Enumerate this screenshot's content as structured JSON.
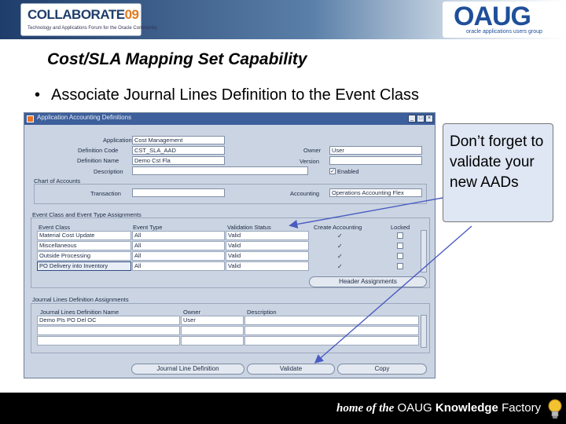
{
  "header": {
    "collaborate_logo": "COLLABORATE",
    "collaborate_year": "09",
    "collaborate_tagline": "Technology and Applications Forum for the Oracle Community",
    "oaug_logo": "OAUG",
    "oaug_tagline": "oracle applications users group"
  },
  "slide": {
    "title": "Cost/SLA Mapping Set Capability",
    "bullet": "Associate Journal Lines Definition to the Event Class"
  },
  "window": {
    "title": "Application Accounting Definitions",
    "fields": {
      "application_label": "Application",
      "application_value": "Cost Management",
      "definition_code_label": "Definition Code",
      "definition_code_value": "CST_SLA_AAD",
      "definition_name_label": "Definition Name",
      "definition_name_value": "Demo Cst Fla",
      "description_label": "Description",
      "description_value": "",
      "owner_label": "Owner",
      "owner_value": "User",
      "version_label": "Version",
      "version_value": "",
      "enabled_label": "Enabled",
      "chart_of_accounts_label": "Chart of Accounts",
      "transaction_label": "Transaction",
      "transaction_value": "",
      "accounting_label": "Accounting",
      "accounting_value": "Operations Accounting Flex"
    },
    "event_section_title": "Event Class and Event Type Assignments",
    "event_table": {
      "headers": [
        "Event Class",
        "Event Type",
        "Validation Status",
        "Create Accounting",
        "Locked"
      ],
      "rows": [
        {
          "event_class": "Material Cost Update",
          "event_type": "All",
          "status": "Valid",
          "create": "✓",
          "locked": ""
        },
        {
          "event_class": "Miscellaneous",
          "event_type": "All",
          "status": "Valid",
          "create": "✓",
          "locked": ""
        },
        {
          "event_class": "Outside Processing",
          "event_type": "All",
          "status": "Valid",
          "create": "✓",
          "locked": ""
        },
        {
          "event_class": "PO Delivery into Inventory",
          "event_type": "All",
          "status": "Valid",
          "create": "✓",
          "locked": ""
        }
      ]
    },
    "header_assignments_button": "Header Assignments",
    "jld_section_title": "Journal Lines Definition Assignments",
    "jld_table": {
      "headers": [
        "Journal Lines Definition Name",
        "Owner",
        "Description"
      ],
      "rows": [
        {
          "name": "Demo PIs PO Del OC",
          "owner": "User",
          "description": ""
        },
        {
          "name": "",
          "owner": "",
          "description": ""
        },
        {
          "name": "",
          "owner": "",
          "description": ""
        }
      ]
    },
    "buttons": {
      "journal_line_definition": "Journal Line Definition",
      "validate": "Validate",
      "copy": "Copy"
    },
    "controls": {
      "minimize": "_",
      "maximize": "□",
      "close": "×"
    }
  },
  "callout": {
    "text": "Don’t forget to validate your new AADs"
  },
  "footer": {
    "home_of_the": "home of the",
    "oaug": "OAUG",
    "knowledge": "Knowledge",
    "factory": "Factory"
  },
  "icons": [
    "window-menu-icon",
    "minimize-icon",
    "maximize-icon",
    "close-icon",
    "bulb-icon",
    "checkbox-icon"
  ]
}
